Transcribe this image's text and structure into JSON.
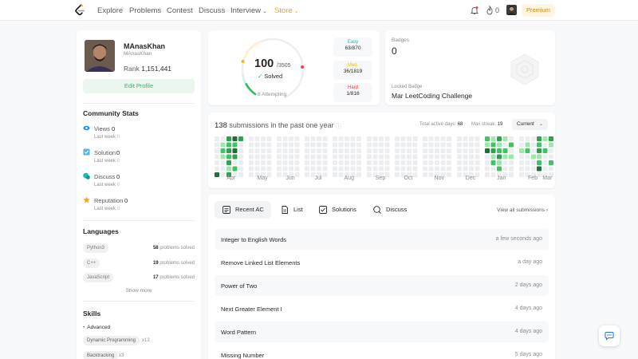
{
  "nav": {
    "links": [
      "Explore",
      "Problems",
      "Contest",
      "Discuss",
      "Interview",
      "Store"
    ],
    "streak": "0",
    "premium": "Premium"
  },
  "profile": {
    "name": "MAnasKhan",
    "username": "MAnasKhan",
    "rank_label": "Rank",
    "rank": "1,151,441",
    "edit": "Edit Profile"
  },
  "community": {
    "title": "Community Stats",
    "last_week_label": "Last week",
    "items": [
      {
        "label": "Views",
        "value": "0",
        "last_week": "0",
        "icon": "eye-icon",
        "color": "#1890ff"
      },
      {
        "label": "Solution",
        "value": "0",
        "last_week": "0",
        "icon": "solution-icon",
        "color": "#5ab5ef"
      },
      {
        "label": "Discuss",
        "value": "0",
        "last_week": "0",
        "icon": "discuss-icon",
        "color": "#13c2c2"
      },
      {
        "label": "Reputation",
        "value": "0",
        "last_week": "0",
        "icon": "star-icon",
        "color": "#ffa116"
      }
    ]
  },
  "languages": {
    "title": "Languages",
    "items": [
      {
        "name": "Python3",
        "count": "58",
        "suffix": "problems solved"
      },
      {
        "name": "C++",
        "count": "19",
        "suffix": "problems solved"
      },
      {
        "name": "JavaScript",
        "count": "17",
        "suffix": "problems solved"
      }
    ],
    "show_more": "Show more"
  },
  "skills": {
    "title": "Skills",
    "level": "Advanced",
    "items": [
      {
        "name": "Dynamic Programming",
        "count": "x12"
      },
      {
        "name": "Backtracking",
        "count": "x3"
      }
    ]
  },
  "solved": {
    "count": "100",
    "total": "/3505",
    "label": "Solved",
    "attempting": "8 Attempting",
    "fraction": 0.0285,
    "difficulties": [
      {
        "label": "Easy",
        "value": "63/870",
        "color": "#1cbaba"
      },
      {
        "label": "Med.",
        "value": "36/1819",
        "color": "#ffb700"
      },
      {
        "label": "Hard",
        "value": "1/816",
        "color": "#f63737"
      }
    ]
  },
  "badges": {
    "label": "Badges",
    "count": "0",
    "locked_label": "Locked Badge",
    "locked_name": "Mar LeetCoding Challenge"
  },
  "heatmap": {
    "count": "138",
    "title_suffix": "submissions in the past one year",
    "active_label": "Total active days:",
    "active": "68",
    "streak_label": "Max streak:",
    "streak": "19",
    "period": "Current",
    "months": [
      "Apr",
      "May",
      "Jun",
      "Jul",
      "Aug",
      "Sep",
      "Oct",
      "Nov",
      "Dec",
      "Jan",
      "Feb",
      "Mar"
    ],
    "colors": {
      "empty": "#ebedf0",
      "l1": "#9be9a8",
      "l2": "#40c463",
      "l3": "#30a14e",
      "l4": "#216e39"
    }
  },
  "recent": {
    "tabs": [
      {
        "label": "Recent AC",
        "icon": "list-icon"
      },
      {
        "label": "List",
        "icon": "document-icon"
      },
      {
        "label": "Solutions",
        "icon": "checkbox-icon"
      },
      {
        "label": "Discuss",
        "icon": "discuss-icon"
      }
    ],
    "view_all": "View all submissions",
    "rows": [
      {
        "title": "Integer to English Words",
        "time": "a few seconds ago"
      },
      {
        "title": "Remove Linked List Elements",
        "time": "a day ago"
      },
      {
        "title": "Power of Two",
        "time": "2 days ago"
      },
      {
        "title": "Next Greater Element I",
        "time": "4 days ago"
      },
      {
        "title": "Word Pattern",
        "time": "4 days ago"
      },
      {
        "title": "Missing Number",
        "time": "5 days ago"
      }
    ]
  }
}
